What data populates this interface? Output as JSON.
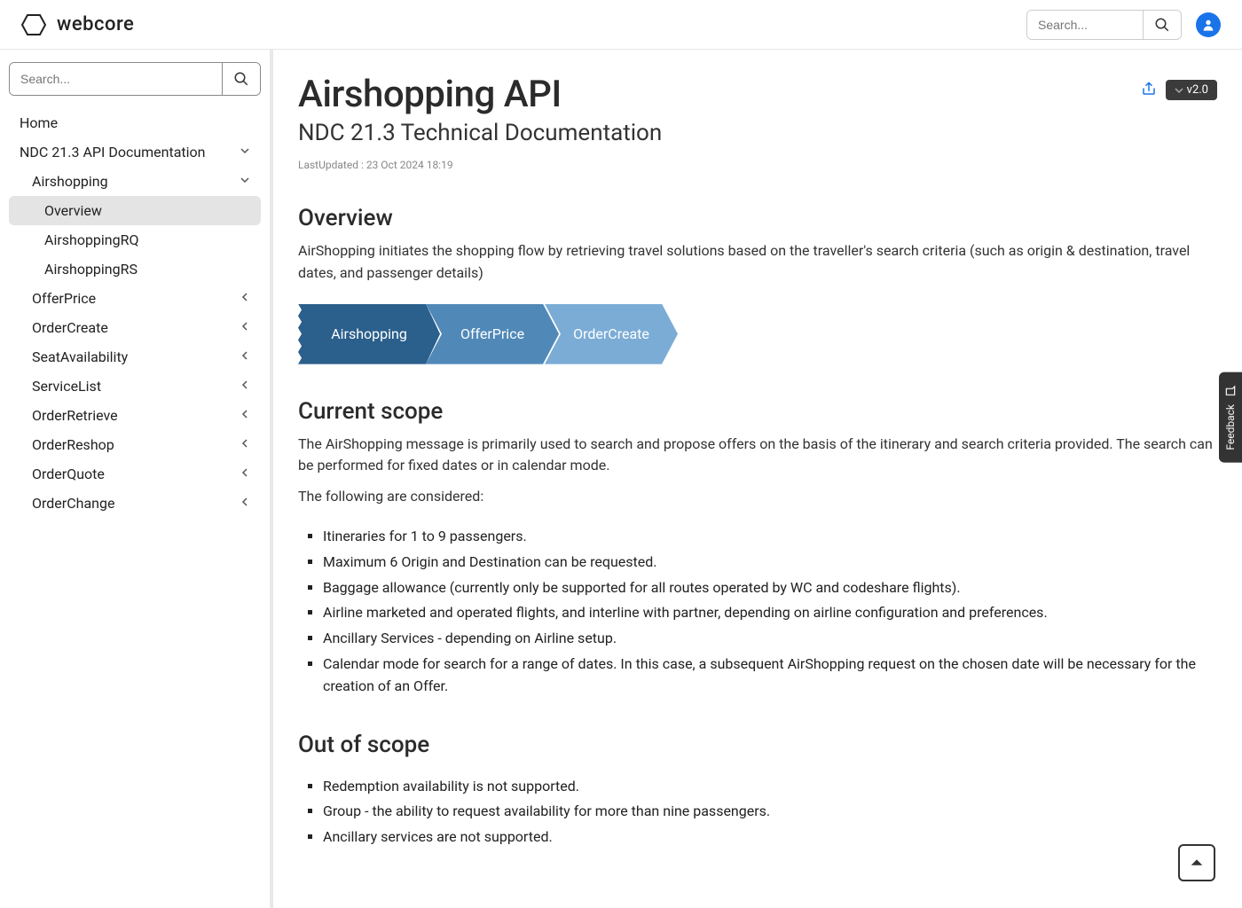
{
  "brand": {
    "name": "webcore"
  },
  "header": {
    "search_placeholder": "Search..."
  },
  "sidebar": {
    "search_placeholder": "Search...",
    "items": [
      {
        "label": "Home",
        "level": 0,
        "expand": null
      },
      {
        "label": "NDC 21.3 API Documentation",
        "level": 0,
        "expand": "down"
      },
      {
        "label": "Airshopping",
        "level": 1,
        "expand": "down"
      },
      {
        "label": "Overview",
        "level": 2,
        "expand": null,
        "active": true
      },
      {
        "label": "AirshoppingRQ",
        "level": 2,
        "expand": null
      },
      {
        "label": "AirshoppingRS",
        "level": 2,
        "expand": null
      },
      {
        "label": "OfferPrice",
        "level": 1,
        "expand": "left"
      },
      {
        "label": "OrderCreate",
        "level": 1,
        "expand": "left"
      },
      {
        "label": "SeatAvailability",
        "level": 1,
        "expand": "left"
      },
      {
        "label": "ServiceList",
        "level": 1,
        "expand": "left"
      },
      {
        "label": "OrderRetrieve",
        "level": 1,
        "expand": "left"
      },
      {
        "label": "OrderReshop",
        "level": 1,
        "expand": "left"
      },
      {
        "label": "OrderQuote",
        "level": 1,
        "expand": "left"
      },
      {
        "label": "OrderChange",
        "level": 1,
        "expand": "left"
      }
    ]
  },
  "page": {
    "title": "Airshopping API",
    "subtitle": "NDC 21.3 Technical Documentation",
    "last_updated": "LastUpdated : 23 Oct 2024 18:19",
    "version": "v2.0"
  },
  "sections": {
    "overview": {
      "heading": "Overview",
      "text": "AirShopping initiates the shopping flow by retrieving travel solutions based on the traveller's search criteria (such as origin & destination, travel dates, and passenger details)"
    },
    "flow": {
      "step1": "Airshopping",
      "step2": "OfferPrice",
      "step3": "OrderCreate"
    },
    "current_scope": {
      "heading": "Current scope",
      "text": "The AirShopping message is primarily used to search and propose offers on the basis of the itinerary and search criteria provided. The search can be performed for fixed dates or in calendar mode.",
      "lead": "The following are considered:",
      "items": [
        "Itineraries for 1 to 9 passengers.",
        "Maximum 6 Origin and Destination can be requested.",
        "Baggage allowance (currently only be supported for all routes operated by WC and codeshare flights).",
        "Airline marketed and operated flights, and interline with partner, depending on airline configuration and preferences.",
        "Ancillary Services - depending on Airline setup.",
        "Calendar mode for search for a range of dates. In this case, a subsequent AirShopping request on the chosen date will be necessary for the creation of an Offer."
      ]
    },
    "out_of_scope": {
      "heading": "Out of scope",
      "items": [
        "Redemption availability is not supported.",
        "Group - the ability to request availability for more than nine passengers.",
        "Ancillary services are not supported."
      ]
    }
  },
  "feedback": {
    "label": "Feedback"
  }
}
